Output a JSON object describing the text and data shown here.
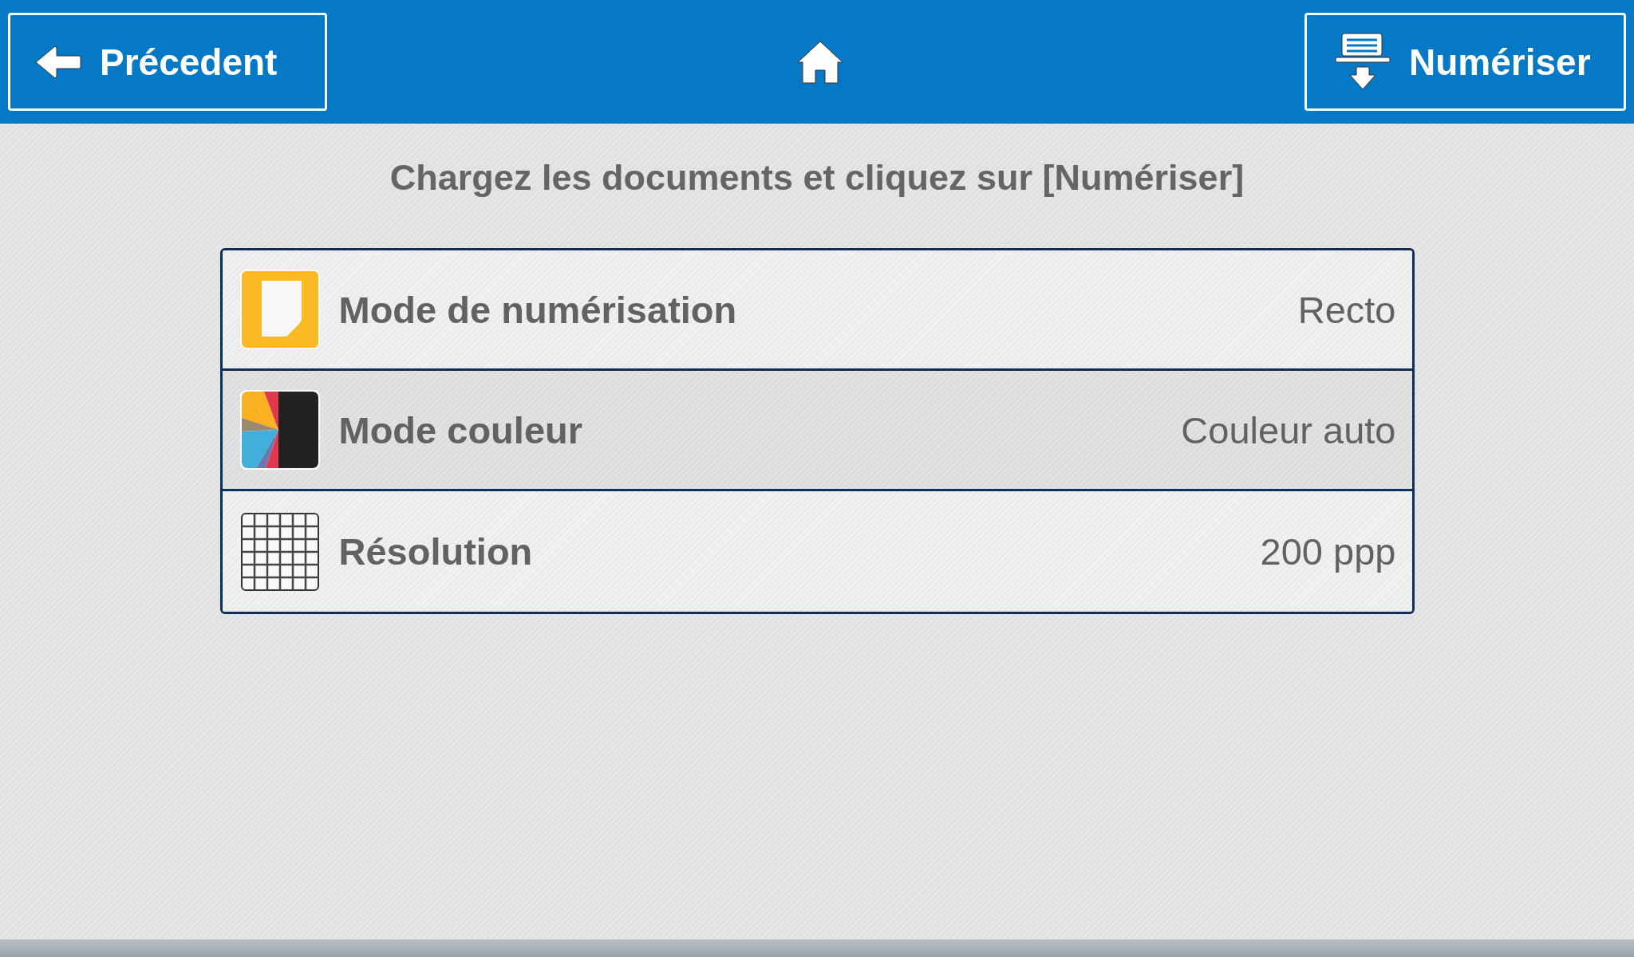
{
  "header": {
    "back_button": "Précedent",
    "scan_button": "Numériser"
  },
  "instruction": "Chargez les documents et cliquez sur [Numériser]",
  "settings": [
    {
      "kind": "page",
      "label": "Mode de numérisation",
      "value": "Recto"
    },
    {
      "kind": "color",
      "label": "Mode couleur",
      "value": "Couleur auto"
    },
    {
      "kind": "grid",
      "label": "Résolution",
      "value": "200 ppp"
    }
  ]
}
